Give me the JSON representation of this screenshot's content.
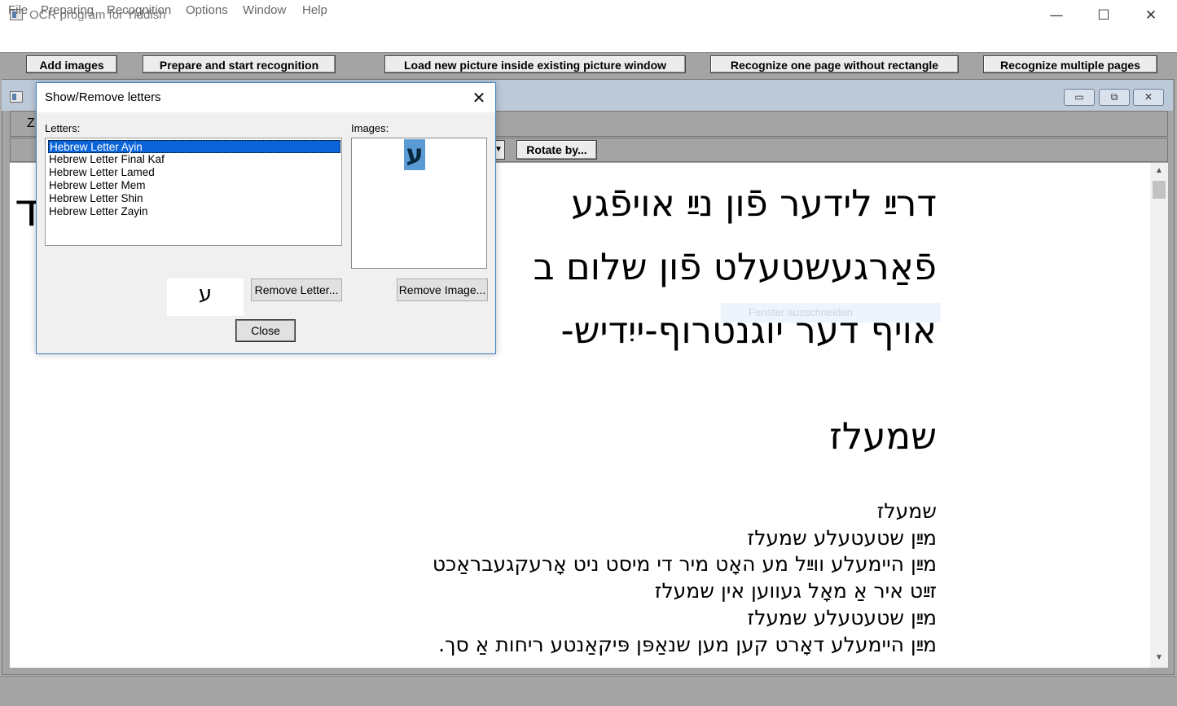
{
  "window": {
    "title": "OCR program for Yiddish",
    "minimize_glyph": "—",
    "maximize_glyph": "☐",
    "close_glyph": "✕"
  },
  "menubar": [
    "File",
    "Preparing",
    "Recognition",
    "Options",
    "Window",
    "Help"
  ],
  "toolbar": {
    "add_images": "Add images",
    "prepare_start": "Prepare and start recognition",
    "load_new_picture": "Load new picture inside existing picture window",
    "recognize_one_page": "Recognize one page without rectangle",
    "recognize_multiple": "Recognize multiple pages"
  },
  "child_window": {
    "minimize_glyph": "▭",
    "restore_glyph": "⧉",
    "close_glyph": "✕",
    "tab_fragment": "Z",
    "rotate_button": "Rotate by...",
    "dropdown_glyph": "▼"
  },
  "document": {
    "left_fragment": "ד",
    "heading_lines": [
      "דרײַ לידער פֿון נײַ אויפֿגע",
      "פֿאַרגעשטעלט פֿון שלום ב",
      "אויף דער יוגנטרוף-ייִדיש-"
    ],
    "poem_title": "שמעלז",
    "poem_lines": [
      "שמעלז",
      "מײַן שטעטעלע שמעלז",
      "מײַן היימעלע ווײַל מע האָט מיר די מיסט ניט אָרעקגעבראַכט",
      "זײַט איר אַ מאָל געווען אין שמעלז",
      "מײַן שטעטעלע שמעלז",
      "מײַן היימעלע דאָרט קען מען שנאַפּן פּיקאַנטע ריחות אַ סך."
    ],
    "faded_tooltip": "Fenster ausschneiden"
  },
  "scrollbar": {
    "up": "▲",
    "down": "▼"
  },
  "dialog": {
    "title": "Show/Remove letters",
    "close_glyph": "✕",
    "letters_label": "Letters:",
    "images_label": "Images:",
    "letters": [
      "Hebrew Letter Ayin",
      "Hebrew Letter Final Kaf",
      "Hebrew Letter Lamed",
      "Hebrew Letter Mem",
      "Hebrew Letter Shin",
      "Hebrew Letter Zayin"
    ],
    "selected_index": 0,
    "image_glyph": "ע",
    "preview_glyph": "ע",
    "remove_letter": "Remove Letter...",
    "remove_image": "Remove Image...",
    "close": "Close"
  }
}
